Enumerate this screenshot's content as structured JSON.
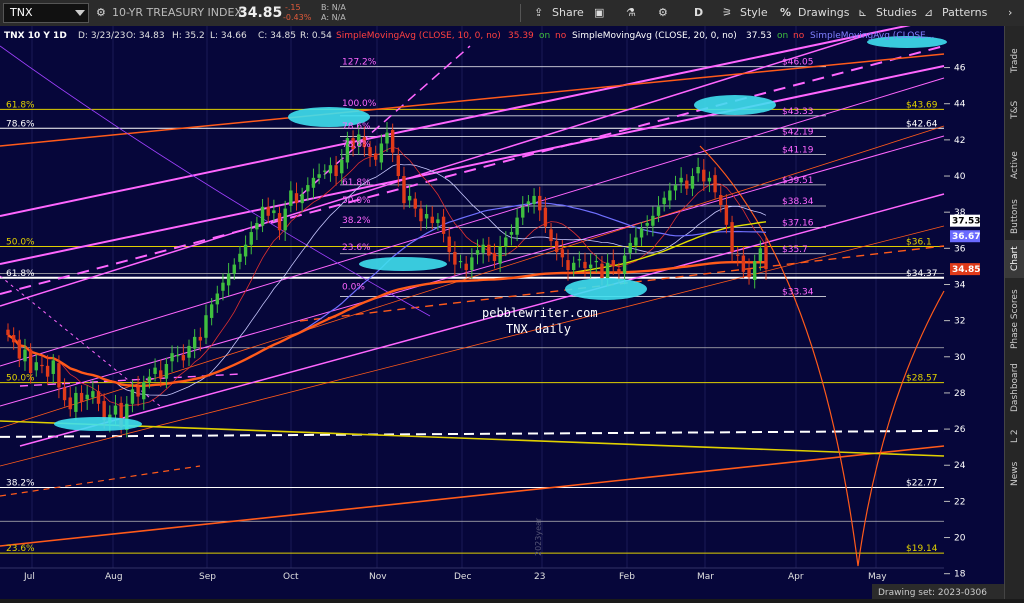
{
  "toolbar": {
    "symbol": "TNX",
    "description": "10-YR TREASURY INDEX",
    "last": "34.85",
    "change": "-.15",
    "change_pct": "-0.43%",
    "bid_label": "B: N/A",
    "ask_label": "A: N/A",
    "share": "Share",
    "timeframe": "D",
    "style": "Style",
    "drawings": "Drawings",
    "studies": "Studies",
    "patterns": "Patterns"
  },
  "header": {
    "info": "TNX 10 Y 1D",
    "date": "D: 3/23/23",
    "open": "O: 34.83",
    "high": "H: 35.2",
    "low": "L: 34.66",
    "close": "C: 34.85",
    "range": "R: 0.54",
    "sma10": "SimpleMovingAvg (CLOSE, 10, 0, no)",
    "sma10_val": "35.39",
    "sma20": "SimpleMovingAvg (CLOSE, 20, 0, no)",
    "sma20_val": "37.53",
    "sma_extra": "SimpleMovingAvg (CLOSE...",
    "on": "on",
    "no": "no"
  },
  "right_tabs": [
    "Trade",
    "T&S",
    "Active Trader",
    "Buttons",
    "Chart",
    "Phase Scores",
    "Dashboard",
    "L 2",
    "News"
  ],
  "footer": {
    "drawing_set": "Drawing set: 2023-0306"
  },
  "colors": {
    "background": "#06063a",
    "up_candle": "#3fbf3f",
    "down_candle": "#e03a1a",
    "sma10": "#e03030",
    "sma20": "#c8c8ff",
    "sma50": "#7070ff",
    "sma100": "#e0e000",
    "sma200": "#ff5a1a",
    "channel": "#ff66ff",
    "fib_gold": "#e0d000",
    "cyan_highlight": "#3fe0f0"
  },
  "chart_data": {
    "type": "candlestick",
    "symbol": "TNX",
    "xlabel": "",
    "ylabel": "",
    "ylim": [
      16.6,
      48.3
    ],
    "x_ticks": [
      "Jul",
      "Aug",
      "Sep",
      "Oct",
      "Nov",
      "Dec",
      "23",
      "Feb",
      "Mar",
      "Apr",
      "May"
    ],
    "y_ticks": [
      18,
      20,
      22,
      24,
      26,
      28,
      30,
      32,
      34,
      36,
      38,
      40,
      42,
      44,
      46
    ],
    "watermark_line1": "pebblewriter.com",
    "watermark_line2": "TNX daily",
    "year_marker": "2023year",
    "price_tags": [
      {
        "value": 37.53,
        "label": "37.53",
        "color": "#ffffff",
        "text": "#000000"
      },
      {
        "value": 36.67,
        "label": "36.67",
        "color": "#6a6aff",
        "text": "#ffffff"
      },
      {
        "value": 34.85,
        "label": "34.85",
        "color": "#e03a1a",
        "text": "#ffffff"
      }
    ],
    "fib_right": [
      {
        "label": "$46.05",
        "value": 46.05,
        "color": "#ff66ff"
      },
      {
        "label": "$43.33",
        "value": 43.33,
        "color": "#ff66ff"
      },
      {
        "label": "$42.19",
        "value": 42.19,
        "color": "#ff66ff"
      },
      {
        "label": "$41.19",
        "value": 41.19,
        "color": "#ff66ff"
      },
      {
        "label": "$39.51",
        "value": 39.51,
        "color": "#ff66ff"
      },
      {
        "label": "$38.34",
        "value": 38.34,
        "color": "#ff66ff"
      },
      {
        "label": "$37.16",
        "value": 37.16,
        "color": "#ff66ff"
      },
      {
        "label": "$35.7",
        "value": 35.7,
        "color": "#ff66ff"
      },
      {
        "label": "$33.34",
        "value": 33.34,
        "color": "#ff66ff"
      }
    ],
    "fib_left": [
      {
        "label": "127.2%",
        "value": 46.05
      },
      {
        "label": "100.0%",
        "value": 43.75
      },
      {
        "label": "78.6%",
        "value": 42.5
      },
      {
        "label": "78.6%",
        "value": 41.5
      },
      {
        "label": "61.8%",
        "value": 39.4
      },
      {
        "label": "50.0%",
        "value": 38.4
      },
      {
        "label": "38.2%",
        "value": 37.3
      },
      {
        "label": "23.6%",
        "value": 35.8
      },
      {
        "label": "0.0%",
        "value": 33.6
      }
    ],
    "gold_levels": [
      {
        "left": "61.8%",
        "right": "$43.69",
        "value": 43.69,
        "color": "#e0d000"
      },
      {
        "left": "78.6%",
        "right": "$42.64",
        "value": 42.64,
        "color": "#ffffff"
      },
      {
        "left": "50.0%",
        "right": "$36.1",
        "value": 36.1,
        "color": "#e0d000"
      },
      {
        "left": "61.8%",
        "right": "$34.37",
        "value": 34.37,
        "color": "#ffffff"
      },
      {
        "left": "50.0%",
        "right": "$28.57",
        "value": 28.57,
        "color": "#e0d000"
      },
      {
        "left": "38.2%",
        "right": "$22.77",
        "value": 22.77,
        "color": "#ffffff"
      },
      {
        "left": "23.6%",
        "right": "$19.14",
        "value": 19.14,
        "color": "#e0d000"
      }
    ],
    "plain_lines": [
      30.5,
      20.9,
      34.6
    ],
    "dashed_white": 25.9,
    "closes": [
      31.2,
      30.8,
      29.9,
      30.4,
      29.1,
      29.7,
      29.5,
      28.9,
      29.8,
      28.3,
      27.6,
      27.1,
      28.0,
      27.5,
      27.9,
      28.1,
      27.4,
      26.5,
      26.8,
      27.3,
      26.1,
      27.4,
      28.2,
      27.8,
      28.6,
      28.9,
      29.4,
      28.8,
      29.6,
      30.2,
      30.1,
      29.8,
      30.6,
      31.1,
      30.9,
      32.3,
      32.9,
      33.5,
      34.1,
      34.6,
      35.1,
      35.7,
      36.2,
      36.9,
      37.4,
      38.3,
      37.8,
      38.1,
      37.0,
      38.2,
      39.2,
      38.5,
      39.0,
      39.5,
      39.9,
      40.1,
      40.3,
      40.6,
      40.0,
      40.9,
      42.1,
      41.5,
      42.3,
      41.6,
      41.1,
      40.9,
      41.8,
      42.4,
      41.3,
      40.0,
      38.5,
      38.9,
      38.2,
      37.5,
      37.9,
      37.4,
      37.6,
      36.8,
      35.8,
      35.1,
      35.3,
      34.8,
      35.5,
      35.9,
      36.2,
      35.6,
      35.3,
      36.1,
      36.6,
      36.9,
      37.7,
      38.3,
      38.6,
      38.9,
      38.1,
      37.2,
      36.4,
      35.8,
      35.5,
      34.8,
      35.2,
      35.4,
      34.9,
      35.1,
      35.3,
      34.3,
      35.2,
      35.0,
      34.6,
      35.6,
      36.3,
      36.6,
      37.1,
      37.4,
      37.8,
      38.3,
      38.8,
      39.2,
      39.5,
      39.9,
      39.3,
      40.0,
      40.5,
      39.7,
      39.9,
      39.1,
      38.4,
      37.3,
      35.8,
      35.6,
      34.7,
      34.4,
      35.3,
      36.0,
      34.85
    ]
  }
}
